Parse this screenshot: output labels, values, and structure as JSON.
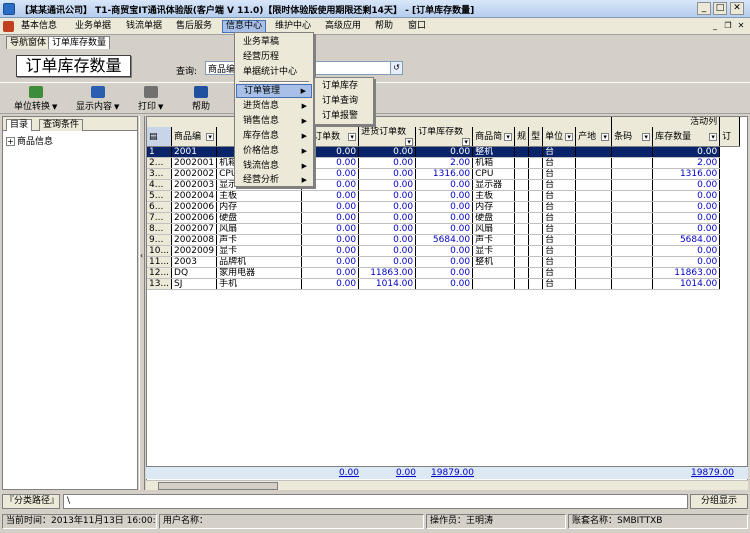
{
  "window": {
    "title": "【某某通讯公司】 T1-商贸宝IT通讯体验版(客户端 V 11.0)【限时体验版使用期限还剩14天】 - [订单库存数量]",
    "minimize": "_",
    "restore": "□",
    "close": "✕"
  },
  "menubar": {
    "items": [
      "基本信息",
      "业务单据",
      "钱流单据",
      "售后服务",
      "信息中心",
      "维护中心",
      "高级应用",
      "帮助",
      "窗口"
    ],
    "controls": [
      "_",
      "❐",
      "✕"
    ]
  },
  "tabs": [
    "导航窗体",
    "订单库存数量"
  ],
  "page_title": "订单库存数量",
  "query": {
    "label": "查询:",
    "value": "商品编号",
    "button": "↺"
  },
  "toolbar": {
    "unit_convert": "单位转换",
    "show_content": "显示内容",
    "print": "打印",
    "help": "帮助"
  },
  "left_panel": {
    "tabs": [
      "目录",
      "查询条件"
    ],
    "tree_root": "商品信息",
    "tree_toggle": "+"
  },
  "splitter_arrow": "‹",
  "grid": {
    "group_header": "活动列",
    "columns": [
      "商品编",
      "",
      "售订单数",
      "进货订单数",
      "订单库存数",
      "商品简",
      "规",
      "型",
      "单位",
      "产地",
      "条码",
      "库存数量",
      "订"
    ],
    "rows": [
      [
        "1",
        "2001",
        "",
        "0.00",
        "0.00",
        "0.00",
        "整机",
        "",
        "",
        "台",
        "",
        "",
        "0.00"
      ],
      [
        "2...",
        "2002001",
        "机箱",
        "0.00",
        "0.00",
        "2.00",
        "机箱",
        "",
        "",
        "台",
        "",
        "",
        "2.00"
      ],
      [
        "3...",
        "2002002",
        "CPU",
        "0.00",
        "0.00",
        "1316.00",
        "CPU",
        "",
        "",
        "台",
        "",
        "",
        "1316.00"
      ],
      [
        "4...",
        "2002003",
        "显示器",
        "0.00",
        "0.00",
        "0.00",
        "显示器",
        "",
        "",
        "台",
        "",
        "",
        "0.00"
      ],
      [
        "5...",
        "2002004",
        "主板",
        "0.00",
        "0.00",
        "0.00",
        "主板",
        "",
        "",
        "台",
        "",
        "",
        "0.00"
      ],
      [
        "6...",
        "2002006",
        "内存",
        "0.00",
        "0.00",
        "0.00",
        "内存",
        "",
        "",
        "台",
        "",
        "",
        "0.00"
      ],
      [
        "7...",
        "2002006",
        "硬盘",
        "0.00",
        "0.00",
        "0.00",
        "硬盘",
        "",
        "",
        "台",
        "",
        "",
        "0.00"
      ],
      [
        "8...",
        "2002007",
        "风扇",
        "0.00",
        "0.00",
        "0.00",
        "风扇",
        "",
        "",
        "台",
        "",
        "",
        "0.00"
      ],
      [
        "9...",
        "2002008",
        "声卡",
        "0.00",
        "0.00",
        "5684.00",
        "声卡",
        "",
        "",
        "台",
        "",
        "",
        "5684.00"
      ],
      [
        "10...",
        "2002009",
        "显卡",
        "0.00",
        "0.00",
        "0.00",
        "显卡",
        "",
        "",
        "台",
        "",
        "",
        "0.00"
      ],
      [
        "11...",
        "2003",
        "品牌机",
        "0.00",
        "0.00",
        "0.00",
        "整机",
        "",
        "",
        "台",
        "",
        "",
        "0.00"
      ],
      [
        "12...",
        "DQ",
        "家用电器",
        "0.00",
        "11863.00",
        "0.00",
        "",
        "",
        "",
        "台",
        "",
        "",
        "11863.00"
      ],
      [
        "13...",
        "SJ",
        "手机",
        "0.00",
        "1014.00",
        "0.00",
        "",
        "",
        "",
        "台",
        "",
        "",
        "1014.00"
      ]
    ],
    "totals": {
      "col_a": "0.00",
      "col_b": "0.00",
      "col_c": "19879.00",
      "stock": "19879.00"
    }
  },
  "path_bar": {
    "label": "『分类路径』",
    "value": "\\",
    "right_button": "分组显示"
  },
  "statusbar": {
    "time": "当前时间：2013年11月13日 16:00:27",
    "user": "用户名称：",
    "operator": "操作员：王明涛",
    "account": "账套名称：SMBITTXB"
  },
  "info_center_menu": {
    "items": [
      "业务草稿",
      "经营历程",
      "单据统计中心",
      "订单管理",
      "进货信息",
      "销售信息",
      "库存信息",
      "价格信息",
      "钱流信息",
      "经营分析"
    ],
    "submenu_arrow": "▶"
  },
  "order_submenu": {
    "items": [
      "订单库存",
      "订单查询",
      "订单报警"
    ]
  }
}
